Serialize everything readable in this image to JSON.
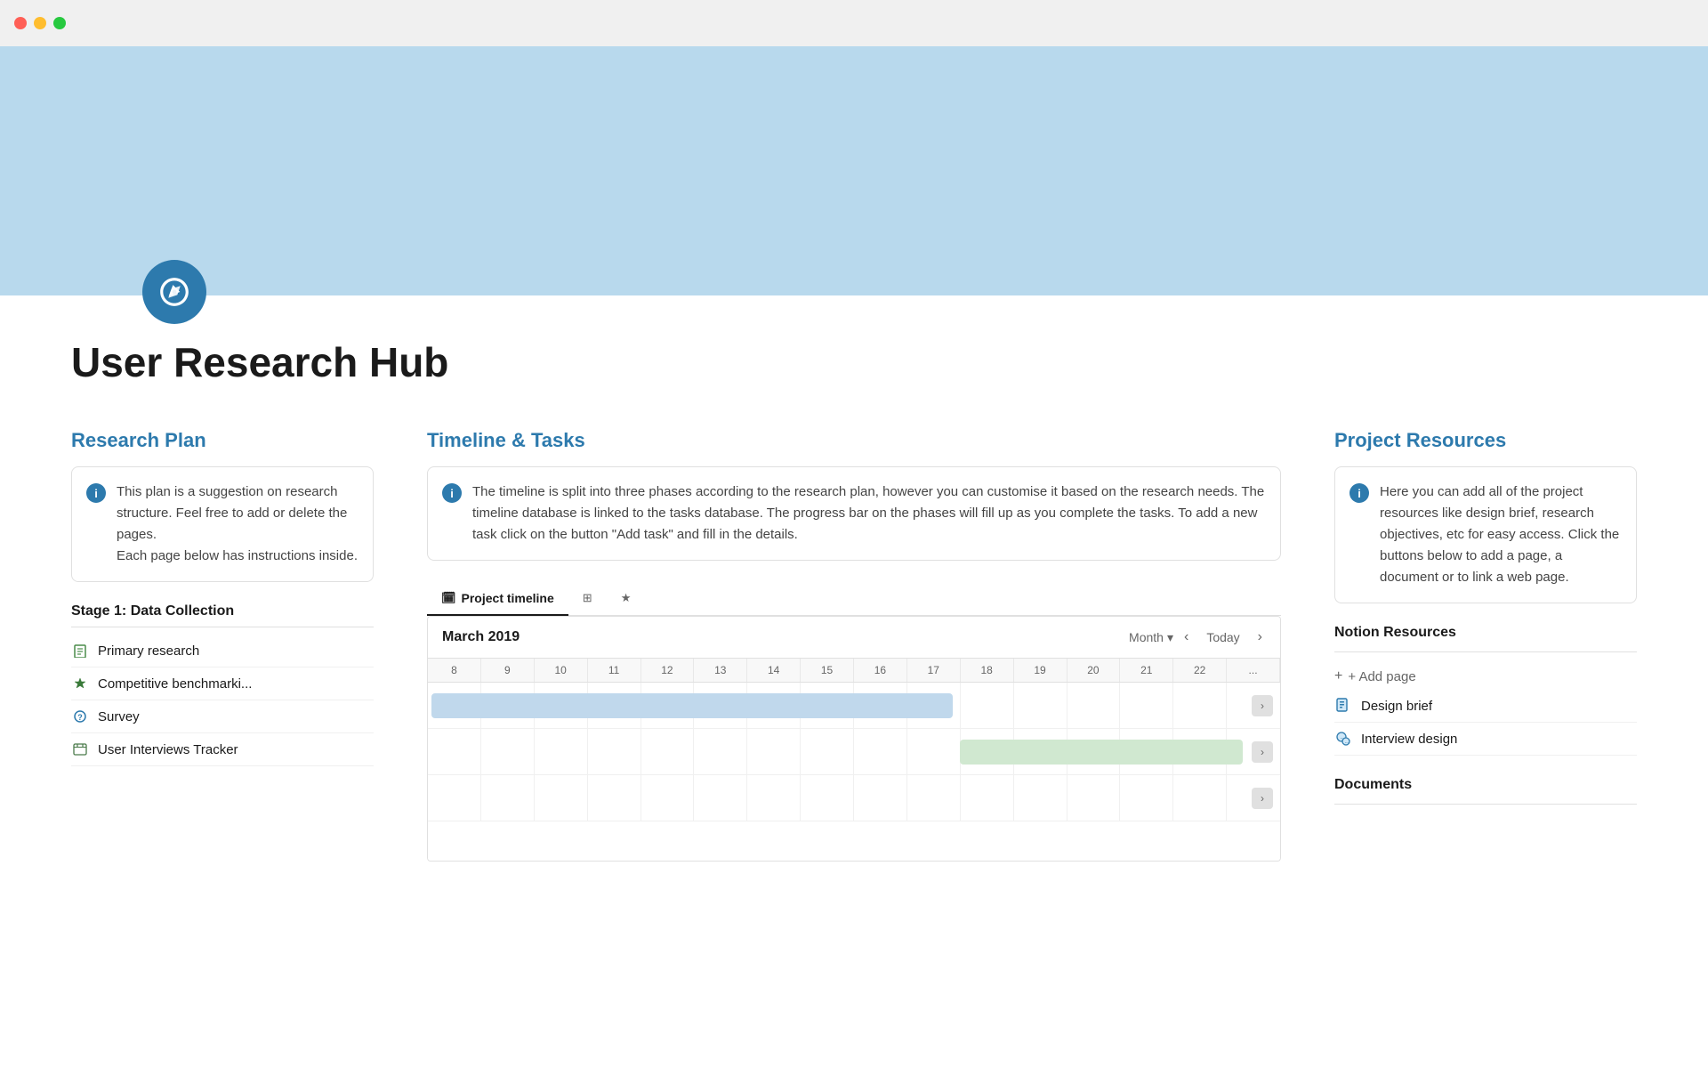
{
  "titlebar": {
    "traffic_lights": [
      "red",
      "yellow",
      "green"
    ]
  },
  "hero": {
    "background_color": "#b8d9ed"
  },
  "page": {
    "title": "User Research Hub",
    "icon_color": "#2d7aad"
  },
  "research_plan": {
    "section_title": "Research Plan",
    "info_text": "This plan is a suggestion on research structure. Feel free to add or delete the pages.\nEach page below has instructions inside.",
    "stage_heading": "Stage 1: Data Collection",
    "nav_items": [
      {
        "label": "Primary research",
        "icon": "📋",
        "icon_type": "primary"
      },
      {
        "label": "Competitive benchmarki...",
        "icon": "🏷",
        "icon_type": "competitive"
      },
      {
        "label": "Survey",
        "icon": "❓",
        "icon_type": "survey"
      },
      {
        "label": "User Interviews Tracker",
        "icon": "📅",
        "icon_type": "interviews"
      }
    ]
  },
  "timeline": {
    "section_title": "Timeline & Tasks",
    "info_text": "The timeline is split into three phases according to the research plan, however you can customise it based on the research needs. The timeline database is linked to the tasks database. The progress bar on the phases will fill up as you complete the tasks. To add a new task click on the button \"Add task\" and fill in the details.",
    "tabs": [
      {
        "label": "Project timeline",
        "icon": "🗓",
        "active": true
      },
      {
        "label": "",
        "icon": "⊞",
        "active": false
      },
      {
        "label": "",
        "icon": "★",
        "active": false
      }
    ],
    "calendar_month": "March 2019",
    "month_btn_label": "Month",
    "today_btn_label": "Today",
    "day_numbers": [
      "8",
      "9",
      "10",
      "11",
      "12",
      "13",
      "14",
      "15",
      "16",
      "17",
      "18",
      "19",
      "20",
      "21",
      "2..."
    ],
    "rows": 3
  },
  "resources": {
    "section_title": "Project Resources",
    "info_text": "Here you can add all of the project resources like design brief, research objectives, etc for easy access. Click the buttons below to add a page, a document or to link a web page.",
    "notion_resources_title": "Notion Resources",
    "add_page_label": "+ Add page",
    "items": [
      {
        "label": "Design brief",
        "icon": "💼"
      },
      {
        "label": "Interview design",
        "icon": "💬"
      }
    ],
    "documents_title": "Documents"
  }
}
